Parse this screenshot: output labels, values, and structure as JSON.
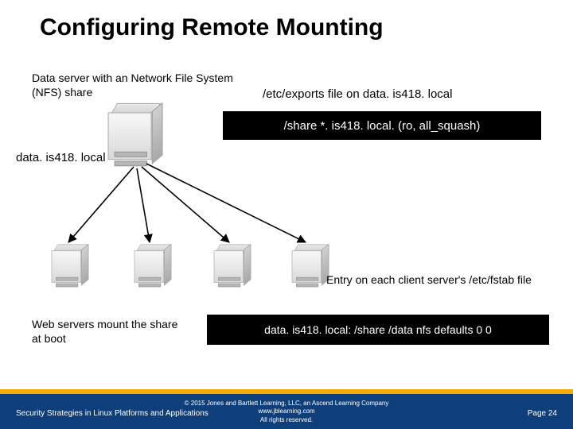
{
  "title": "Configuring Remote Mounting",
  "captions": {
    "server_desc": "Data server with an Network File System (NFS) share",
    "exports_label": "/etc/exports file on data. is418. local",
    "exports_content": "/share *. is418. local. (ro, all_squash)",
    "host_label": "data. is418. local",
    "entry_label": "Entry on each client server's /etc/fstab file",
    "mount_desc": "Web servers mount the share at boot",
    "fstab_entry": "data. is418. local: /share  /data  nfs   defaults  0  0"
  },
  "footer": {
    "left": "Security Strategies in Linux Platforms and Applications",
    "mid_line1": "© 2015 Jones and Bartlett Learning, LLC, an Ascend Learning Company",
    "mid_line2": "www.jblearning.com",
    "mid_line3": "All rights reserved.",
    "page": "Page 24"
  }
}
